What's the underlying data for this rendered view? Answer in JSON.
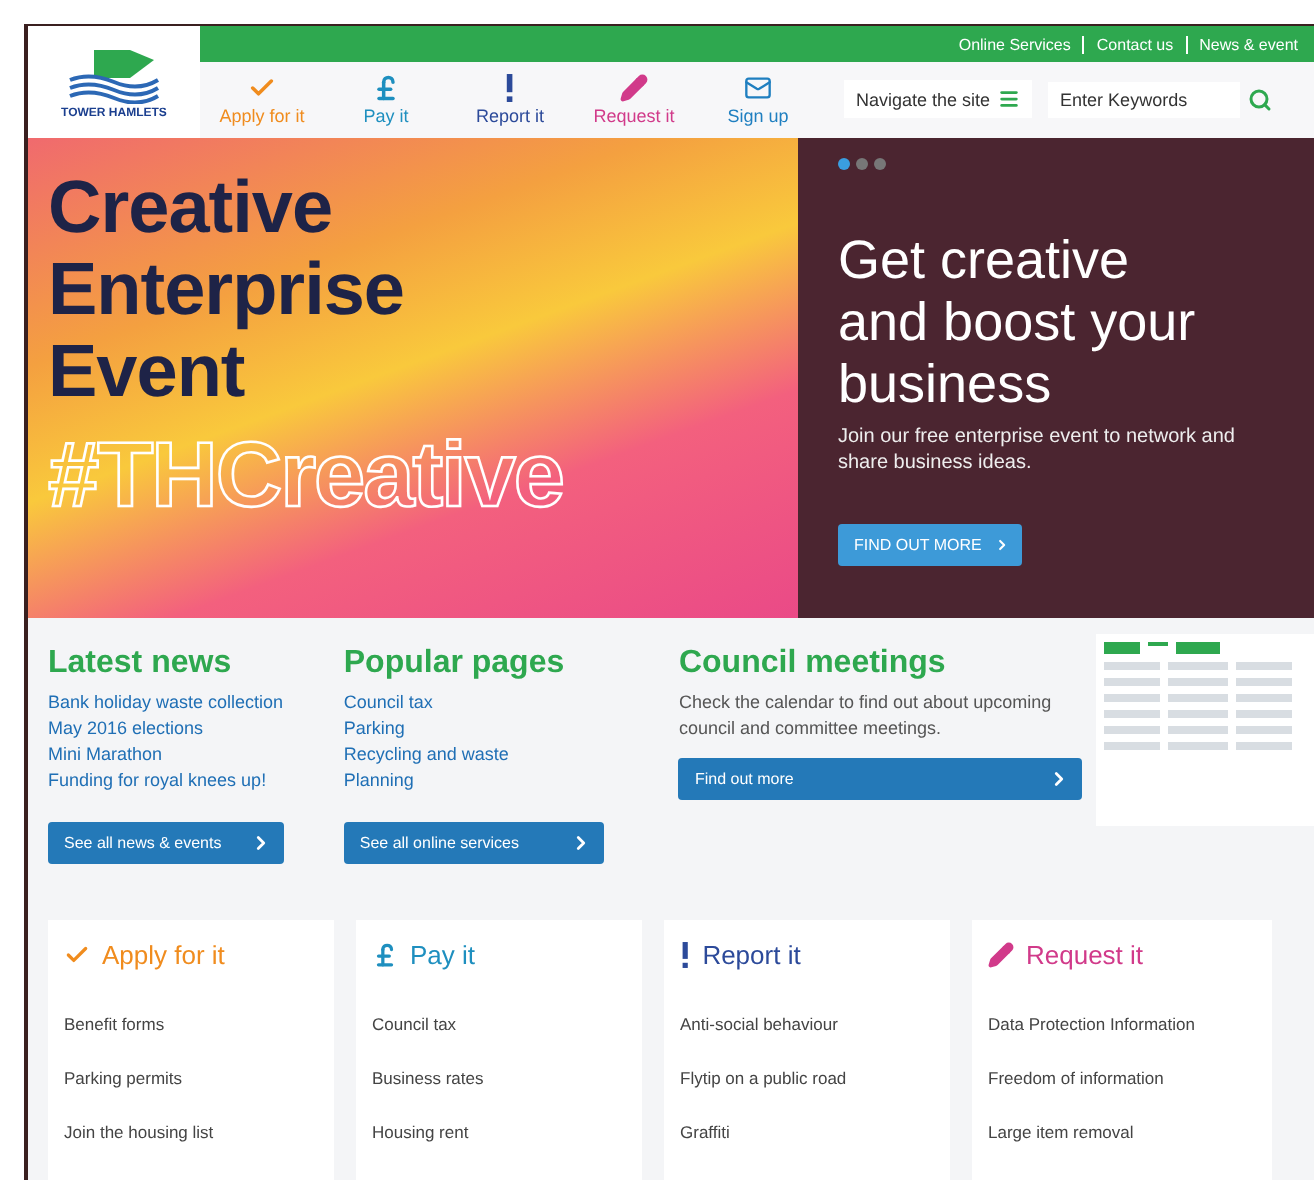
{
  "top_links": [
    "Online Services",
    "Contact us",
    "News & event"
  ],
  "logo": {
    "text": "TOWER HAMLETS"
  },
  "nav": [
    {
      "label": "Apply for it",
      "kind": "check",
      "color": "#f08c1e"
    },
    {
      "label": "Pay it",
      "kind": "pound",
      "color": "#1e8fbf"
    },
    {
      "label": "Report it",
      "kind": "exclaim",
      "color": "#2c4a9a"
    },
    {
      "label": "Request it",
      "kind": "pencil",
      "color": "#d13a8a"
    },
    {
      "label": "Sign up",
      "kind": "mail",
      "color": "#1f7fc0"
    }
  ],
  "navigate": {
    "label": "Navigate the site"
  },
  "search": {
    "placeholder": "Enter Keywords"
  },
  "hero": {
    "headline": [
      "Creative",
      "Enterprise",
      "Event"
    ],
    "hashtag": "#THCreative"
  },
  "slide": {
    "dots": [
      {
        "selected": true
      },
      {
        "selected": false
      },
      {
        "selected": false
      }
    ],
    "title": "Get creative and boost your business",
    "text": "Join our free enterprise event to network and share business ideas.",
    "button": "FIND OUT MORE"
  },
  "latest_news": {
    "title": "Latest news",
    "links": [
      "Bank holiday waste collection",
      "May 2016 elections",
      "Mini Marathon",
      "Funding for royal knees up!"
    ],
    "button": "See all news & events"
  },
  "popular_pages": {
    "title": "Popular pages",
    "links": [
      "Council tax",
      "Parking",
      "Recycling and waste",
      "Planning"
    ],
    "button": "See all online services"
  },
  "council_meetings": {
    "title": "Council meetings",
    "text": "Check the calendar to find out about upcoming council and committee meetings.",
    "button": "Find out more"
  },
  "cards": [
    {
      "title": "Apply for it",
      "kind": "check",
      "color": "#f08c1e",
      "links": [
        "Benefit forms",
        "Parking permits",
        "Join the housing list"
      ]
    },
    {
      "title": "Pay it",
      "kind": "pound",
      "color": "#1e8fbf",
      "links": [
        "Council tax",
        "Business rates",
        "Housing rent"
      ]
    },
    {
      "title": "Report it",
      "kind": "exclaim",
      "color": "#2c4a9a",
      "links": [
        "Anti-social behaviour",
        "Flytip on a public road",
        "Graffiti"
      ]
    },
    {
      "title": "Request it",
      "kind": "pencil",
      "color": "#d13a8a",
      "links": [
        "Data Protection Information",
        "Freedom of information",
        "Large item removal"
      ]
    }
  ]
}
